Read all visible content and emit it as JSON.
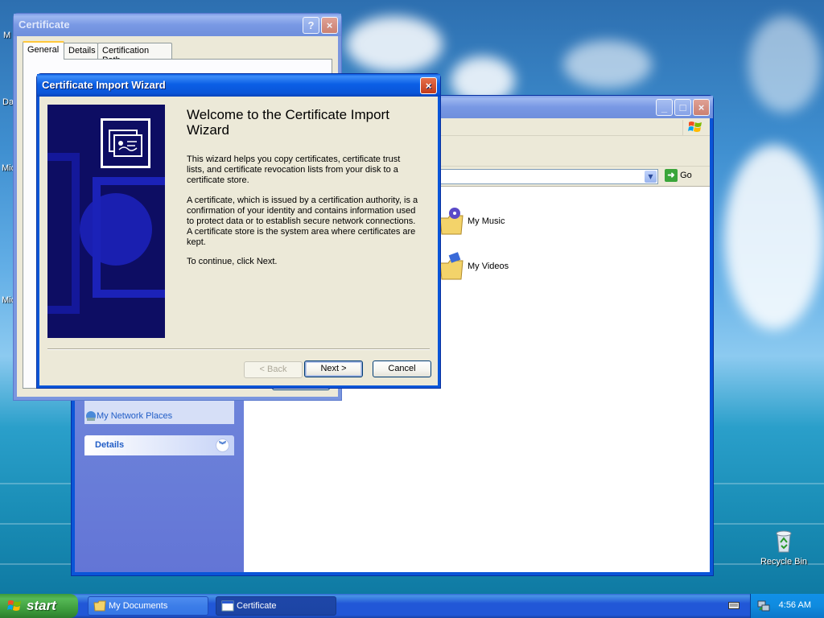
{
  "desktop": {
    "edge_labels": [
      "M",
      "Da",
      "Mic",
      "Mic"
    ],
    "recycle_bin_label": "Recycle Bin"
  },
  "explorer": {
    "go_label": "Go",
    "taskpane": {
      "other_places_link": "My Network Places",
      "details_header": "Details"
    },
    "items": [
      {
        "label": "My Music",
        "icon": "music-folder-icon"
      },
      {
        "label": "My Videos",
        "icon": "video-folder-icon"
      }
    ]
  },
  "certificate_window": {
    "title": "Certificate",
    "help_button": "?",
    "close_button": "×",
    "tabs": [
      "General",
      "Details",
      "Certification Path"
    ]
  },
  "wizard": {
    "title": "Certificate Import Wizard",
    "close_button": "×",
    "heading": "Welcome to the Certificate Import Wizard",
    "paragraphs": [
      "This wizard helps you copy certificates, certificate trust lists, and certificate revocation lists from your disk to a certificate store.",
      "A certificate, which is issued by a certification authority, is a confirmation of your identity and contains information used to protect data or to establish secure network connections. A certificate store is the system area where certificates are kept.",
      "To continue, click Next."
    ],
    "buttons": {
      "back": "< Back",
      "next": "Next >",
      "cancel": "Cancel"
    }
  },
  "taskbar": {
    "start_label": "start",
    "tasks": [
      {
        "label": "My Documents",
        "active": false
      },
      {
        "label": "Certificate",
        "active": true
      }
    ],
    "clock": "4:56 AM"
  },
  "colors": {
    "xp_title_blue": "#0a55d8",
    "taskbar_blue": "#2157d7",
    "start_green": "#3a983a",
    "wizard_banner": "#0d0d63"
  }
}
